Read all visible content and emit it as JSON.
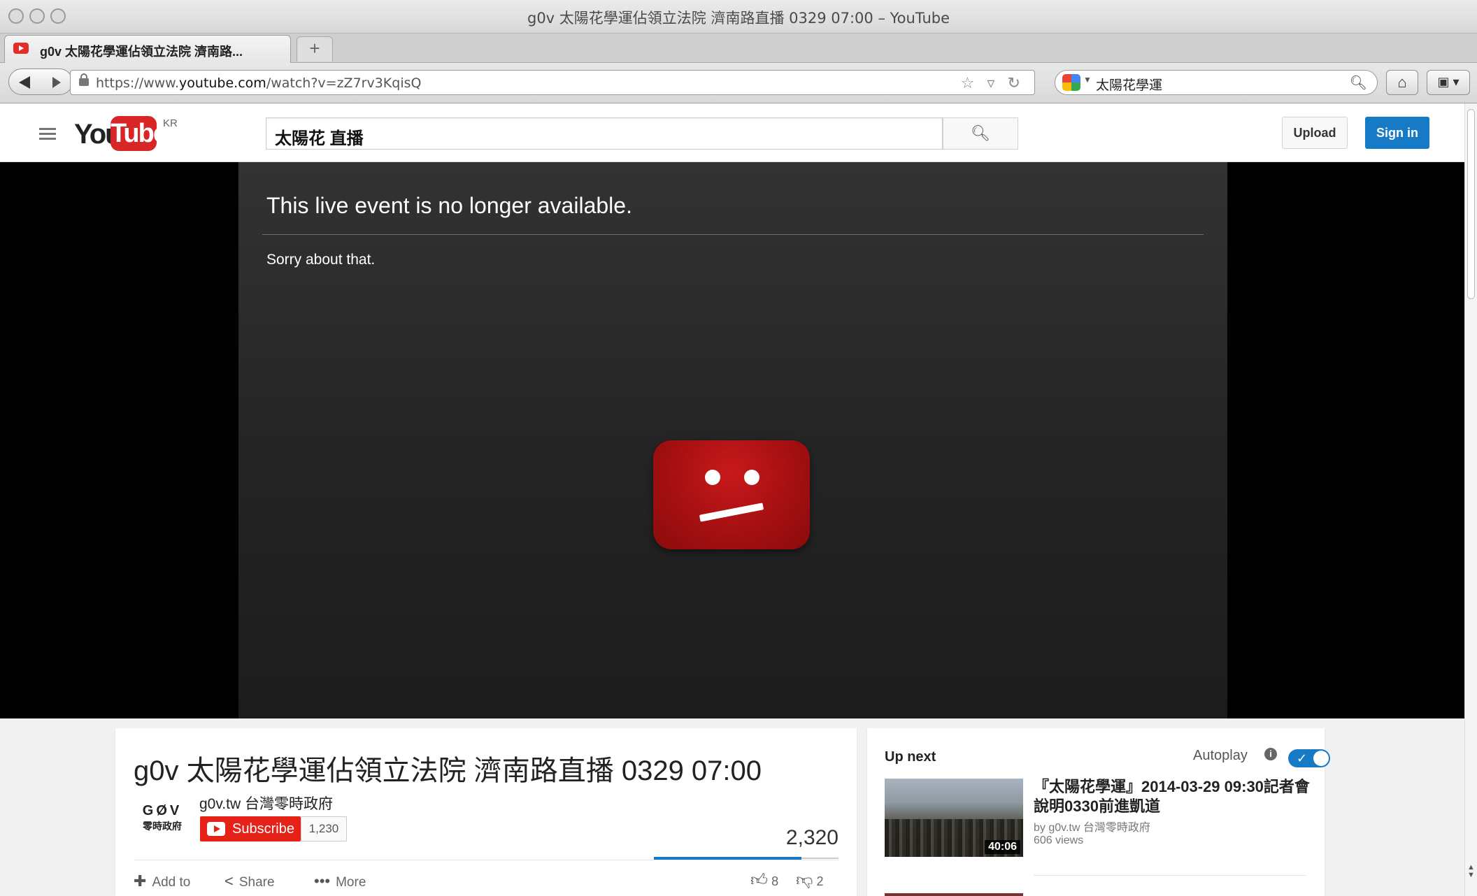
{
  "browser": {
    "window_title": "g0v 太陽花學運佔領立法院 濟南路直播 0329 07:00 – YouTube",
    "tab_label": "g0v 太陽花學運佔領立法院 濟南路...",
    "new_tab_label": "+",
    "url_prefix": "https://www.",
    "url_domain": "youtube.com",
    "url_path": "/watch?v=zZ7rv3KqisQ",
    "search_text": "太陽花學運"
  },
  "youtube": {
    "logo_you": "You",
    "logo_tube": "Tube",
    "region": "KR",
    "search_query": "太陽花 直播",
    "upload_label": "Upload",
    "signin_label": "Sign in"
  },
  "player": {
    "error_title": "This live event is no longer available.",
    "error_subtitle": "Sorry about that."
  },
  "video": {
    "title": "g0v 太陽花學運佔領立法院 濟南路直播 0329 07:00",
    "channel_logo_top": "GØV",
    "channel_logo_bottom": "零時政府",
    "channel_name": "g0v.tw 台灣零時政府",
    "subscribe_label": "Subscribe",
    "subscriber_count": "1,230",
    "view_count": "2,320",
    "like_ratio": 0.8,
    "add_to_label": "Add to",
    "share_label": "Share",
    "more_label": "More",
    "likes": "8",
    "dislikes": "2"
  },
  "up_next": {
    "label": "Up next",
    "autoplay_label": "Autoplay",
    "autoplay_on": true,
    "item": {
      "title": "『太陽花學運』2014-03-29 09:30記者會 說明0330前進凱道",
      "by": "by g0v.tw 台灣零時政府",
      "views": "606 views",
      "duration": "40:06"
    }
  },
  "colors": {
    "youtube_red": "#e62117",
    "accent_blue": "#167ac6",
    "error_face_red": "#b01214"
  }
}
